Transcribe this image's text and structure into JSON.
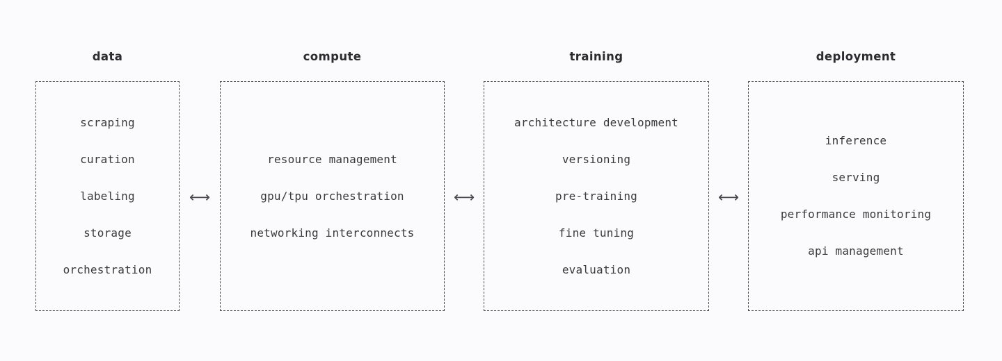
{
  "diagram": {
    "background_color": "#fbfbfe",
    "text_color": "#3a3a3e",
    "heading_color": "#2b2b30",
    "border_color": "#4a4a52",
    "columns": [
      {
        "heading": "data",
        "items": [
          "scraping",
          "curation",
          "labeling",
          "storage",
          "orchestration"
        ]
      },
      {
        "heading": "compute",
        "items": [
          "resource management",
          "gpu/tpu orchestration",
          "networking interconnects"
        ]
      },
      {
        "heading": "training",
        "items": [
          "architecture development",
          "versioning",
          "pre-training",
          "fine tuning",
          "evaluation"
        ]
      },
      {
        "heading": "deployment",
        "items": [
          "inference",
          "serving",
          "performance monitoring",
          "api management"
        ]
      }
    ],
    "connectors": [
      {
        "glyph": "⟷",
        "name": "bidirectional-arrow"
      },
      {
        "glyph": "⟷",
        "name": "bidirectional-arrow"
      },
      {
        "glyph": "⟷",
        "name": "bidirectional-arrow"
      }
    ]
  }
}
